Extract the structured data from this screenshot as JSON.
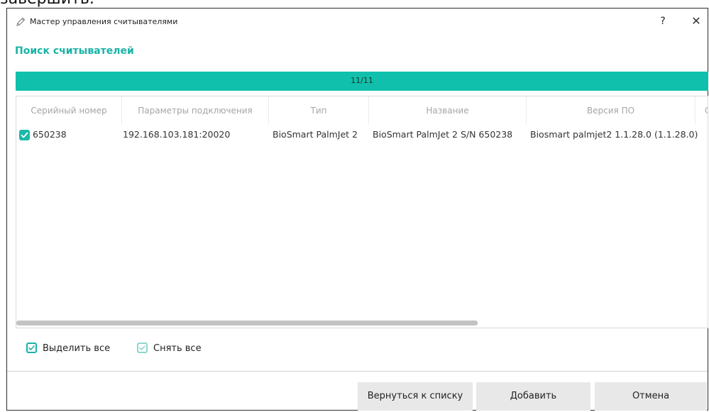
{
  "background_text": "завершить.",
  "window": {
    "title": "Мастер управления считывателями",
    "help_label": "?",
    "close_label": "✕"
  },
  "section_title": "Поиск считывателей",
  "progress": {
    "text": "11/11",
    "current": 11,
    "total": 11,
    "color": "#10c0ac"
  },
  "table": {
    "columns": [
      "Серийный номер",
      "Параметры подключения",
      "Тип",
      "Название",
      "Версия ПО",
      "С"
    ],
    "rows": [
      {
        "checked": true,
        "serial": "650238",
        "connection": "192.168.103.181:20020",
        "type": "BioSmart PalmJet 2",
        "name": "BioSmart PalmJet 2 S/N 650238",
        "version": "Biosmart palmjet2 1.1.28.0 (1.1.28.0)"
      }
    ]
  },
  "options": {
    "select_all": "Выделить все",
    "deselect_all": "Снять все"
  },
  "buttons": {
    "back": "Вернуться к списку",
    "add": "Добавить",
    "cancel": "Отмена"
  },
  "colors": {
    "accent": "#19b3a6",
    "progress": "#10c0ac"
  }
}
